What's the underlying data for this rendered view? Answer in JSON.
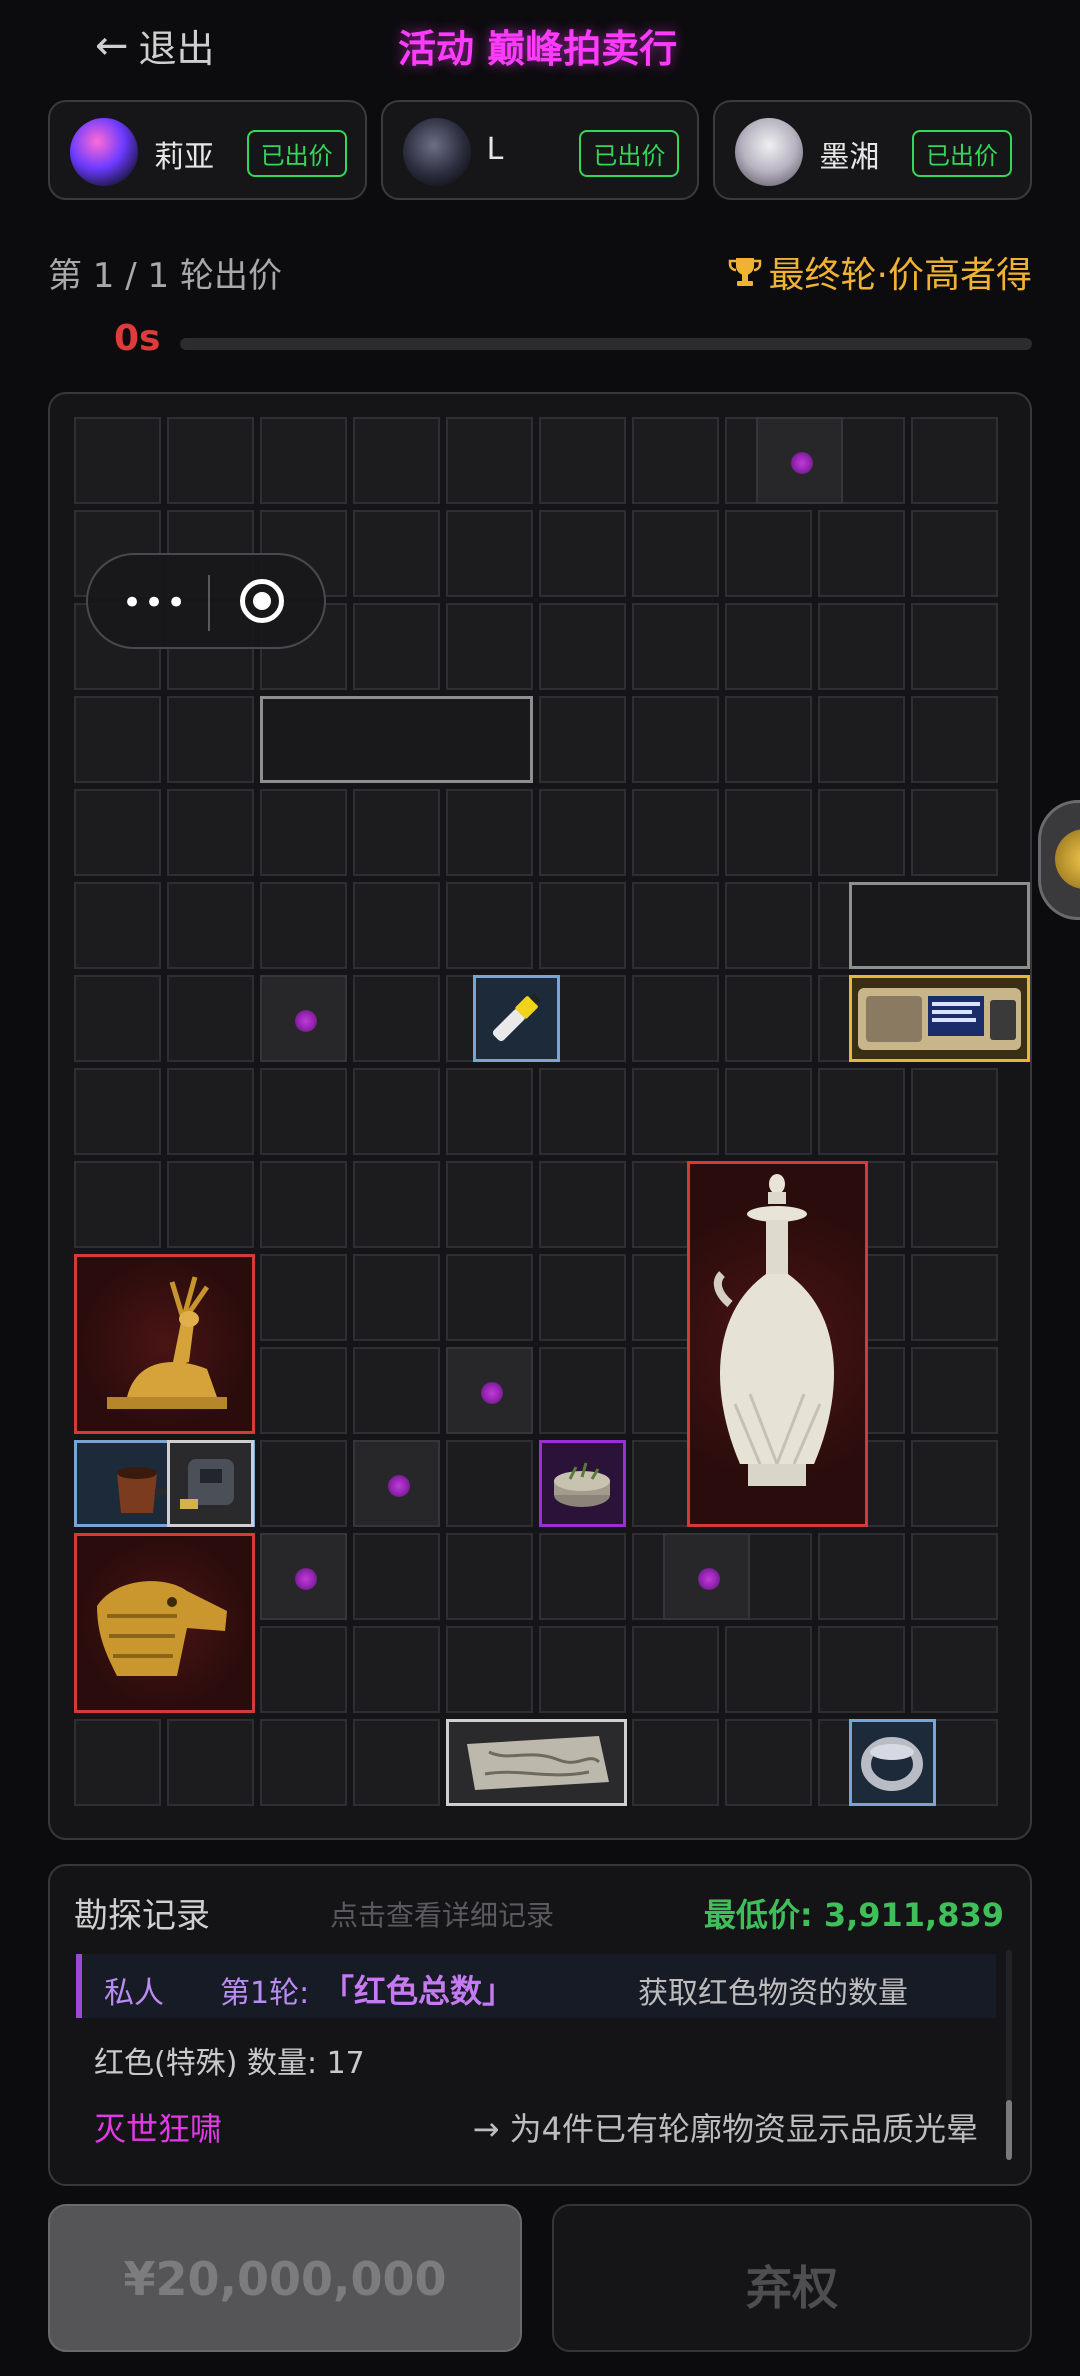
{
  "header": {
    "back_label": "退出",
    "title": "活动 巅峰拍卖行"
  },
  "players": [
    {
      "name": "莉亚",
      "status": "已出价"
    },
    {
      "name": "L",
      "status": "已出价"
    },
    {
      "name": "墨湘",
      "status": "已出价"
    }
  ],
  "round": {
    "text": "第 1 / 1 轮出价",
    "final_text": "最终轮·价高者得"
  },
  "timer": {
    "text": "0s",
    "remaining_fraction": 0
  },
  "log": {
    "title": "勘探记录",
    "hint": "点击查看详细记录",
    "min_price": "最低价: 3,911,839",
    "entry1": {
      "who": "私人",
      "round": "第1轮:",
      "skill": "「红色总数」",
      "desc": "获取红色物资的数量"
    },
    "entry2": "红色(特殊) 数量: 17",
    "entry3": {
      "skill": "灭世狂啸",
      "desc": "→ 为4件已有轮廓物资显示品质光晕"
    }
  },
  "buttons": {
    "bid": "¥20,000,000",
    "waive": "弃权"
  },
  "colors": {
    "accent": "#ff3bff",
    "success": "#36d65a",
    "danger": "#e03b3b",
    "gold": "#f0b232"
  }
}
